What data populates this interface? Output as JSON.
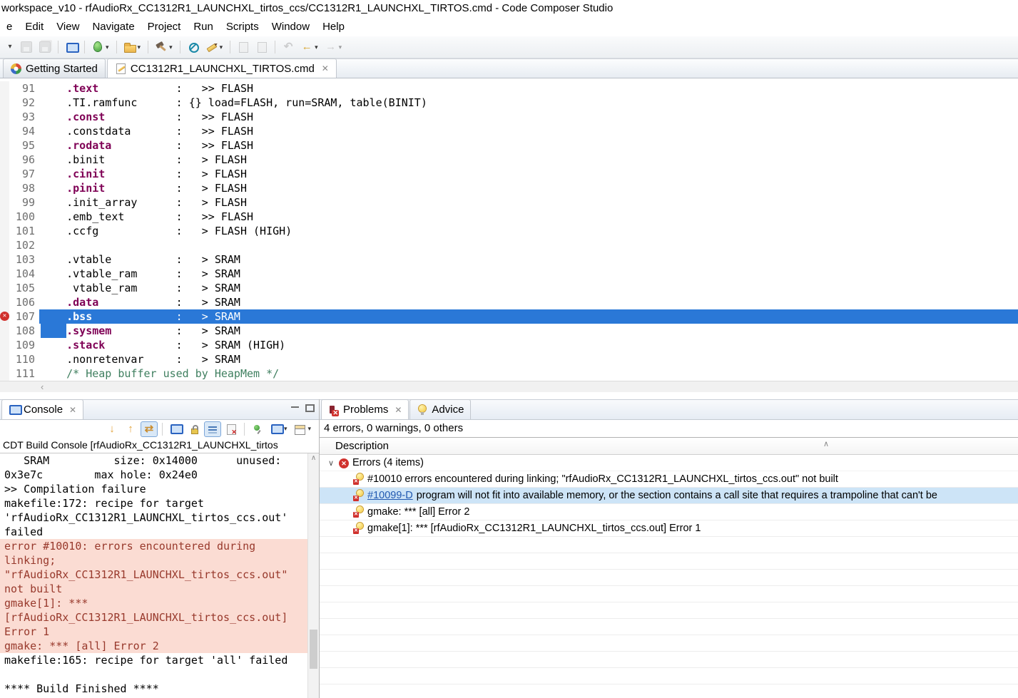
{
  "window": {
    "title": "workspace_v10 - rfAudioRx_CC1312R1_LAUNCHXL_tirtos_ccs/CC1312R1_LAUNCHXL_TIRTOS.cmd - Code Composer Studio"
  },
  "menu": {
    "items": [
      "e",
      "Edit",
      "View",
      "Navigate",
      "Project",
      "Run",
      "Scripts",
      "Window",
      "Help"
    ]
  },
  "main_toolbar": {
    "icons": [
      {
        "name": "menu-dropdown-icon",
        "glyph": "▾"
      },
      {
        "name": "save-icon",
        "disabled": true
      },
      {
        "name": "save-all-icon",
        "disabled": true
      },
      {
        "name": "sep"
      },
      {
        "name": "target-config-icon"
      },
      {
        "name": "sep"
      },
      {
        "name": "debug-icon",
        "dropdown": true
      },
      {
        "name": "sep"
      },
      {
        "name": "import-icon",
        "dropdown": true
      },
      {
        "name": "sep"
      },
      {
        "name": "build-icon",
        "dropdown": true
      },
      {
        "name": "sep"
      },
      {
        "name": "lens-icon"
      },
      {
        "name": "pencil-icon",
        "dropdown": true
      },
      {
        "name": "sep"
      },
      {
        "name": "refresh-icon",
        "disabled": true
      },
      {
        "name": "outline-icon",
        "disabled": true
      },
      {
        "name": "sep"
      },
      {
        "name": "back-history-icon",
        "glyph": "↶",
        "disabled": true
      },
      {
        "name": "back-icon",
        "glyph": "←",
        "dropdown": true
      },
      {
        "name": "forward-icon",
        "glyph": "→",
        "disabled": true,
        "dropdown": true
      }
    ]
  },
  "editor": {
    "tabs": [
      {
        "label": "Getting Started",
        "icon": "getting-started-icon",
        "active": false
      },
      {
        "label": "CC1312R1_LAUNCHXL_TIRTOS.cmd",
        "icon": "cmd-file-icon",
        "active": true,
        "close": "✕"
      }
    ],
    "lines": [
      {
        "n": "91",
        "segs": [
          [
            "    ",
            "p"
          ],
          [
            ".text",
            "k"
          ],
          [
            "            :   >> FLASH",
            "p"
          ]
        ]
      },
      {
        "n": "92",
        "segs": [
          [
            "    .TI.ramfunc      : {} load=FLASH, run=SRAM, table(BINIT)",
            "p"
          ]
        ]
      },
      {
        "n": "93",
        "segs": [
          [
            "    ",
            "p"
          ],
          [
            ".const",
            "k"
          ],
          [
            "           :   >> FLASH",
            "p"
          ]
        ]
      },
      {
        "n": "94",
        "segs": [
          [
            "    .constdata       :   >> FLASH",
            "p"
          ]
        ]
      },
      {
        "n": "95",
        "segs": [
          [
            "    ",
            "p"
          ],
          [
            ".rodata",
            "k"
          ],
          [
            "          :   >> FLASH",
            "p"
          ]
        ]
      },
      {
        "n": "96",
        "segs": [
          [
            "    .binit           :   > FLASH",
            "p"
          ]
        ]
      },
      {
        "n": "97",
        "segs": [
          [
            "    ",
            "p"
          ],
          [
            ".cinit",
            "k"
          ],
          [
            "           :   > FLASH",
            "p"
          ]
        ]
      },
      {
        "n": "98",
        "segs": [
          [
            "    ",
            "p"
          ],
          [
            ".pinit",
            "k"
          ],
          [
            "           :   > FLASH",
            "p"
          ]
        ]
      },
      {
        "n": "99",
        "segs": [
          [
            "    .init_array      :   > FLASH",
            "p"
          ]
        ]
      },
      {
        "n": "100",
        "segs": [
          [
            "    .emb_text        :   >> FLASH",
            "p"
          ]
        ]
      },
      {
        "n": "101",
        "segs": [
          [
            "    .ccfg            :   > FLASH (HIGH)",
            "p"
          ]
        ]
      },
      {
        "n": "102",
        "segs": []
      },
      {
        "n": "103",
        "segs": [
          [
            "    .vtable          :   > SRAM",
            "p"
          ]
        ]
      },
      {
        "n": "104",
        "segs": [
          [
            "    .vtable_ram      :   > SRAM",
            "p"
          ]
        ]
      },
      {
        "n": "105",
        "segs": [
          [
            "     vtable_ram      :   > SRAM",
            "p"
          ]
        ]
      },
      {
        "n": "106",
        "segs": [
          [
            "    ",
            "p"
          ],
          [
            ".data",
            "k"
          ],
          [
            "            :   > SRAM",
            "p"
          ]
        ]
      },
      {
        "n": "107",
        "err": true,
        "sel": true,
        "segs": [
          [
            "    ",
            "p"
          ],
          [
            ".bss",
            "k"
          ],
          [
            "             :   > SRAM",
            "p"
          ]
        ]
      },
      {
        "n": "108",
        "selpre": true,
        "segs": [
          [
            "    ",
            "p"
          ],
          [
            ".sysmem",
            "k"
          ],
          [
            "          :   > SRAM",
            "p"
          ]
        ]
      },
      {
        "n": "109",
        "segs": [
          [
            "    ",
            "p"
          ],
          [
            ".stack",
            "k"
          ],
          [
            "           :   > SRAM (HIGH)",
            "p"
          ]
        ]
      },
      {
        "n": "110",
        "segs": [
          [
            "    .nonretenvar     :   > SRAM",
            "p"
          ]
        ]
      },
      {
        "n": "111",
        "segs": [
          [
            "    /* Heap buffer used by HeapMem */",
            "c"
          ]
        ]
      }
    ],
    "hscroll_left_arrow": "‹"
  },
  "console": {
    "tab_label": "Console",
    "tab_icon": "console-tab-icon",
    "close": "✕",
    "toolbar_icons": [
      {
        "name": "scroll-down-icon",
        "glyph": "↓"
      },
      {
        "name": "scroll-up-icon",
        "glyph": "↑"
      },
      {
        "name": "swap-arrows-icon",
        "glyph": "⇄",
        "toggled": true
      },
      {
        "name": "sep"
      },
      {
        "name": "console-overlay-icon"
      },
      {
        "name": "console-lock-icon"
      },
      {
        "name": "word-wrap-icon",
        "toggled": true
      },
      {
        "name": "clear-console-icon"
      },
      {
        "name": "sep"
      },
      {
        "name": "pin-console-icon"
      },
      {
        "name": "display-console-icon",
        "dropdown": true
      },
      {
        "name": "open-console-icon",
        "dropdown": true
      }
    ],
    "title": "CDT Build Console [rfAudioRx_CC1312R1_LAUNCHXL_tirtos",
    "lines": [
      {
        "t": "   SRAM          size: 0x14000      unused:"
      },
      {
        "t": "0x3e7c        max hole: 0x24e0"
      },
      {
        "t": ">> Compilation failure"
      },
      {
        "t": "makefile:172: recipe for target"
      },
      {
        "t": "'rfAudioRx_CC1312R1_LAUNCHXL_tirtos_ccs.out'"
      },
      {
        "t": "failed"
      },
      {
        "t": "error #10010: errors encountered during",
        "err": true
      },
      {
        "t": "linking;",
        "err": true
      },
      {
        "t": "\"rfAudioRx_CC1312R1_LAUNCHXL_tirtos_ccs.out\"",
        "err": true
      },
      {
        "t": "not built",
        "err": true
      },
      {
        "t": "gmake[1]: ***",
        "err": true
      },
      {
        "t": "[rfAudioRx_CC1312R1_LAUNCHXL_tirtos_ccs.out]",
        "err": true
      },
      {
        "t": "Error 1",
        "err": true
      },
      {
        "t": "gmake: *** [all] Error 2",
        "err": true
      },
      {
        "t": "makefile:165: recipe for target 'all' failed"
      },
      {
        "t": ""
      },
      {
        "t": "**** Build Finished ****"
      }
    ],
    "scroll_up_arrow": "∧"
  },
  "problems": {
    "tabs": [
      {
        "label": "Problems",
        "icon": "problems-tab-icon",
        "active": true,
        "close": "✕"
      },
      {
        "label": "Advice",
        "icon": "advice-icon",
        "active": false
      }
    ],
    "summary": "4 errors, 0 warnings, 0 others",
    "column_header": "Description",
    "sort_indicator": "∧",
    "group": {
      "label": "Errors (4 items)",
      "chevron": "∨",
      "icon_glyph": "✕"
    },
    "items": [
      {
        "text": "#10010 errors encountered during linking; \"rfAudioRx_CC1312R1_LAUNCHXL_tirtos_ccs.out\" not built"
      },
      {
        "link": "#10099-D",
        "text": " program will not fit into available memory, or the section contains a call site that requires a trampoline that can't be",
        "selected": true
      },
      {
        "text": "gmake: *** [all] Error 2"
      },
      {
        "text": "gmake[1]: *** [rfAudioRx_CC1312R1_LAUNCHXL_tirtos_ccs.out] Error 1"
      }
    ],
    "empty_rows": 10
  },
  "colors": {
    "selection_blue": "#2a78d7",
    "keyword_purple": "#7f0055",
    "comment_green": "#3f7f5f",
    "console_error_bg": "#fbdcd3",
    "console_error_text": "#98392c",
    "selected_row_blue": "#cde4f7",
    "error_icon_red": "#d0312d"
  }
}
